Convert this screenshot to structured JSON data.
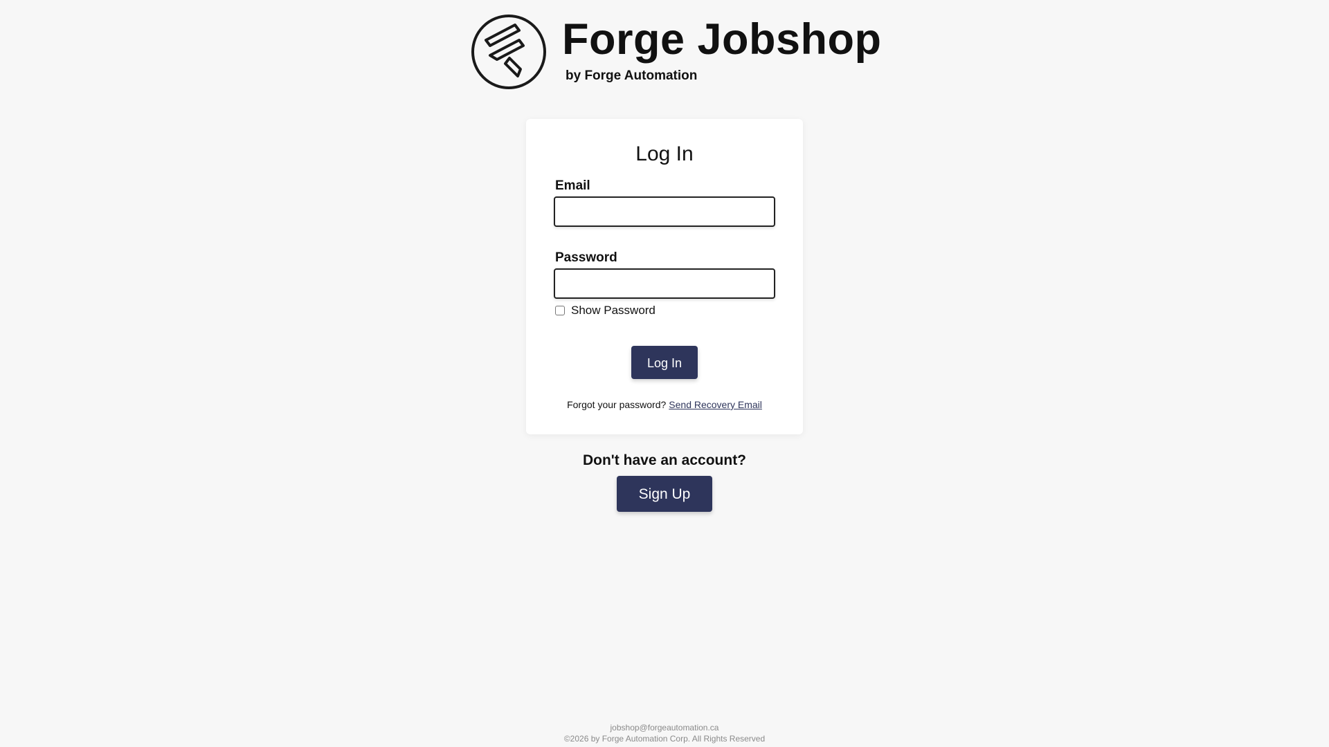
{
  "brand": {
    "logo_icon": "forge-logo-icon",
    "title": "Forge Jobshop",
    "subtitle": "by Forge Automation"
  },
  "login": {
    "title": "Log In",
    "email_label": "Email",
    "email_value": "",
    "password_label": "Password",
    "password_value": "",
    "show_password_label": "Show Password",
    "show_password_checked": false,
    "submit_label": "Log In",
    "forgot_text": "Forgot your password?",
    "recovery_link": "Send Recovery Email"
  },
  "signup": {
    "question": "Don't have an account?",
    "button_label": "Sign Up"
  },
  "footer": {
    "email": "jobshop@forgeautomation.ca",
    "copyright": "©2026 by Forge Automation Corp. All Rights Reserved"
  },
  "colors": {
    "background": "#f7f7f7",
    "card": "#ffffff",
    "primary_button": "#2e355b",
    "text": "#111111",
    "footer_text": "#8a8a8a"
  }
}
